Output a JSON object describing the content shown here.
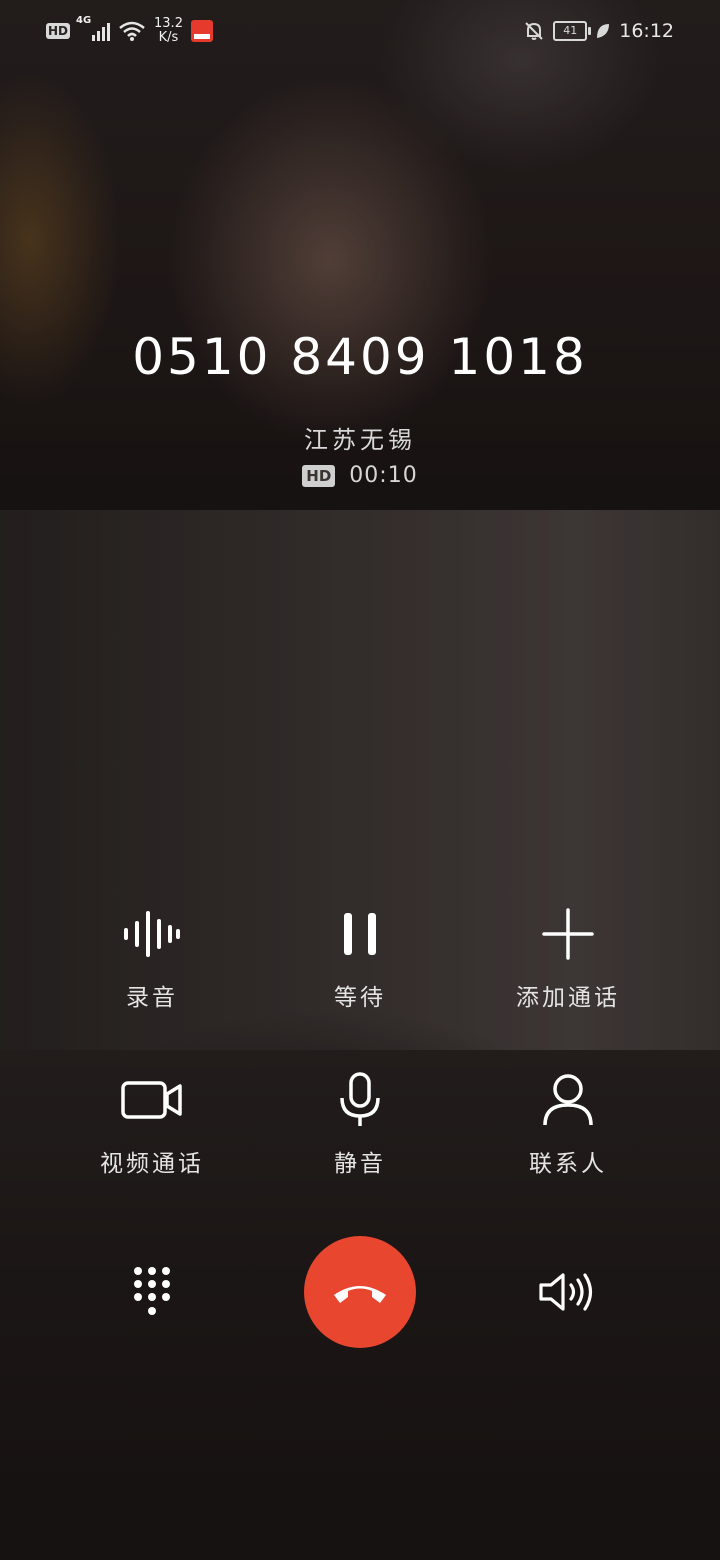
{
  "status_bar": {
    "hd": "HD",
    "network": "4G",
    "speed_value": "13.2",
    "speed_unit": "K/s",
    "battery": "41",
    "time": "16:12"
  },
  "call": {
    "number": "0510 8409 1018",
    "location": "江苏无锡",
    "hd_badge": "HD",
    "duration": "00:10"
  },
  "actions": {
    "record": "录音",
    "hold": "等待",
    "add_call": "添加通话",
    "video_call": "视频通话",
    "mute": "静音",
    "contacts": "联系人"
  },
  "colors": {
    "hangup": "#e8462f",
    "text": "#f2f2f2"
  }
}
